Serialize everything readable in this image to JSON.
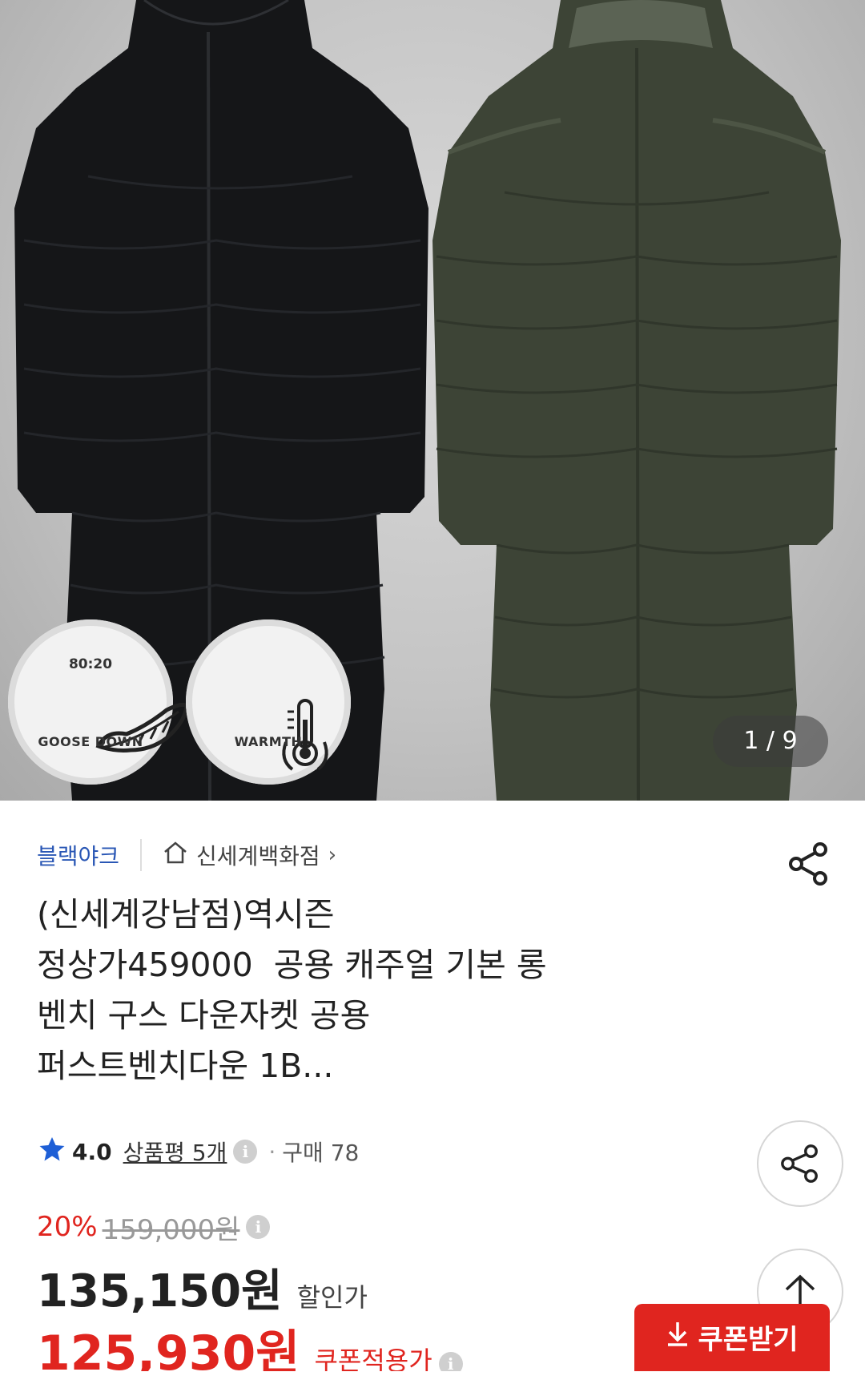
{
  "gallery": {
    "counter": "1 / 9",
    "badges": [
      {
        "top": "80:20",
        "label": "GOOSE DOWN",
        "icon": "feather-icon"
      },
      {
        "top": "",
        "label": "WARMTH",
        "icon": "thermometer-icon"
      }
    ]
  },
  "product": {
    "brand": "블랙야크",
    "store": "신세계백화점",
    "title_lines": [
      "(신세계강남점)역시즌",
      "정상가459000  공용 캐주얼 기본 롱",
      "벤치 구스 다운자켓 공용",
      "퍼스트벤치다운 1B..."
    ],
    "rating": "4.0",
    "reviews": "상품평 5개",
    "purchase": "구매 78"
  },
  "price": {
    "discount_pct": "20%",
    "original": "159,000원",
    "sale": "135,150원",
    "sale_label": "할인가",
    "coupon_price": "125,930원",
    "coupon_label": "쿠폰적용가",
    "coupon_button": "쿠폰받기"
  },
  "colors": {
    "brand_blue": "#2a57b5",
    "accent_red": "#e0251f",
    "star": "#1e5fd6"
  }
}
